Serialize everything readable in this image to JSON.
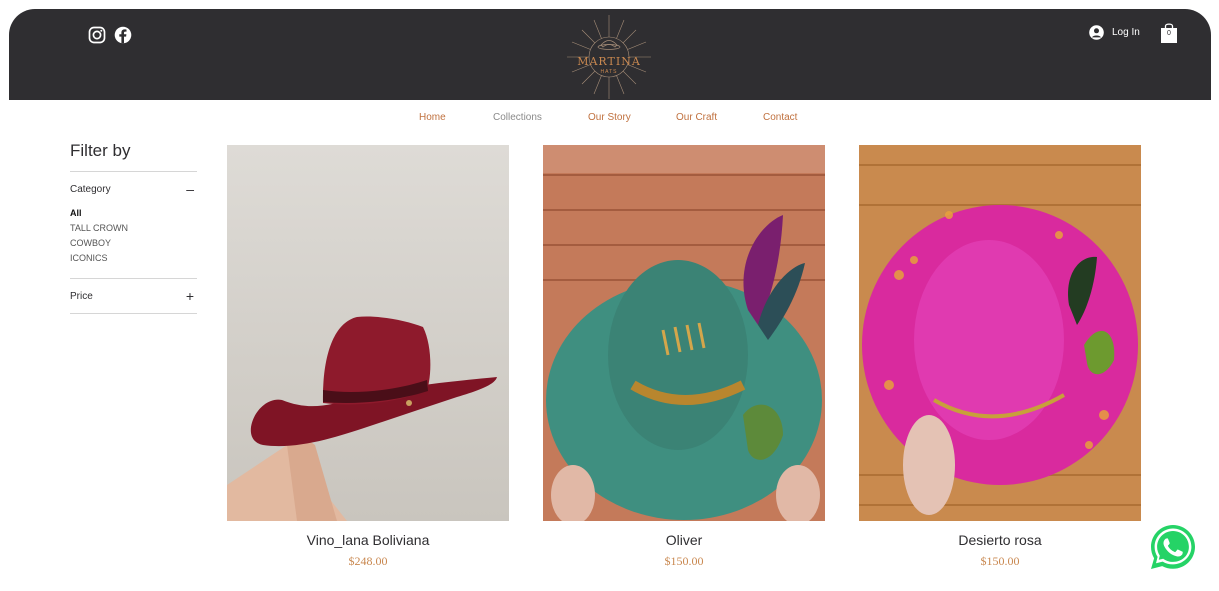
{
  "header": {
    "logo": {
      "name": "MARTINA",
      "sub": "HATS"
    },
    "login_label": "Log In",
    "cart_count": "0",
    "social_icons": [
      "instagram-icon",
      "facebook-icon"
    ]
  },
  "nav": {
    "items": [
      {
        "label": "Home",
        "state": "accent"
      },
      {
        "label": "Collections",
        "state": "muted"
      },
      {
        "label": "Our Story",
        "state": "accent"
      },
      {
        "label": "Our Craft",
        "state": "accent"
      },
      {
        "label": "Contact",
        "state": "accent"
      }
    ]
  },
  "filter": {
    "title": "Filter by",
    "category_label": "Category",
    "category_toggle": "–",
    "categories": [
      "All",
      "TALL CROWN",
      "COWBOY",
      "ICONICS"
    ],
    "price_label": "Price",
    "price_toggle": "+"
  },
  "products": [
    {
      "name": "Vino_lana Boliviana",
      "price": "$248.00"
    },
    {
      "name": "Oliver",
      "price": "$150.00"
    },
    {
      "name": "Desierto rosa",
      "price": "$150.00"
    }
  ],
  "colors": {
    "header_bg": "#2f2e31",
    "accent": "#c0713f",
    "price": "#c98850",
    "whatsapp": "#25d366"
  }
}
